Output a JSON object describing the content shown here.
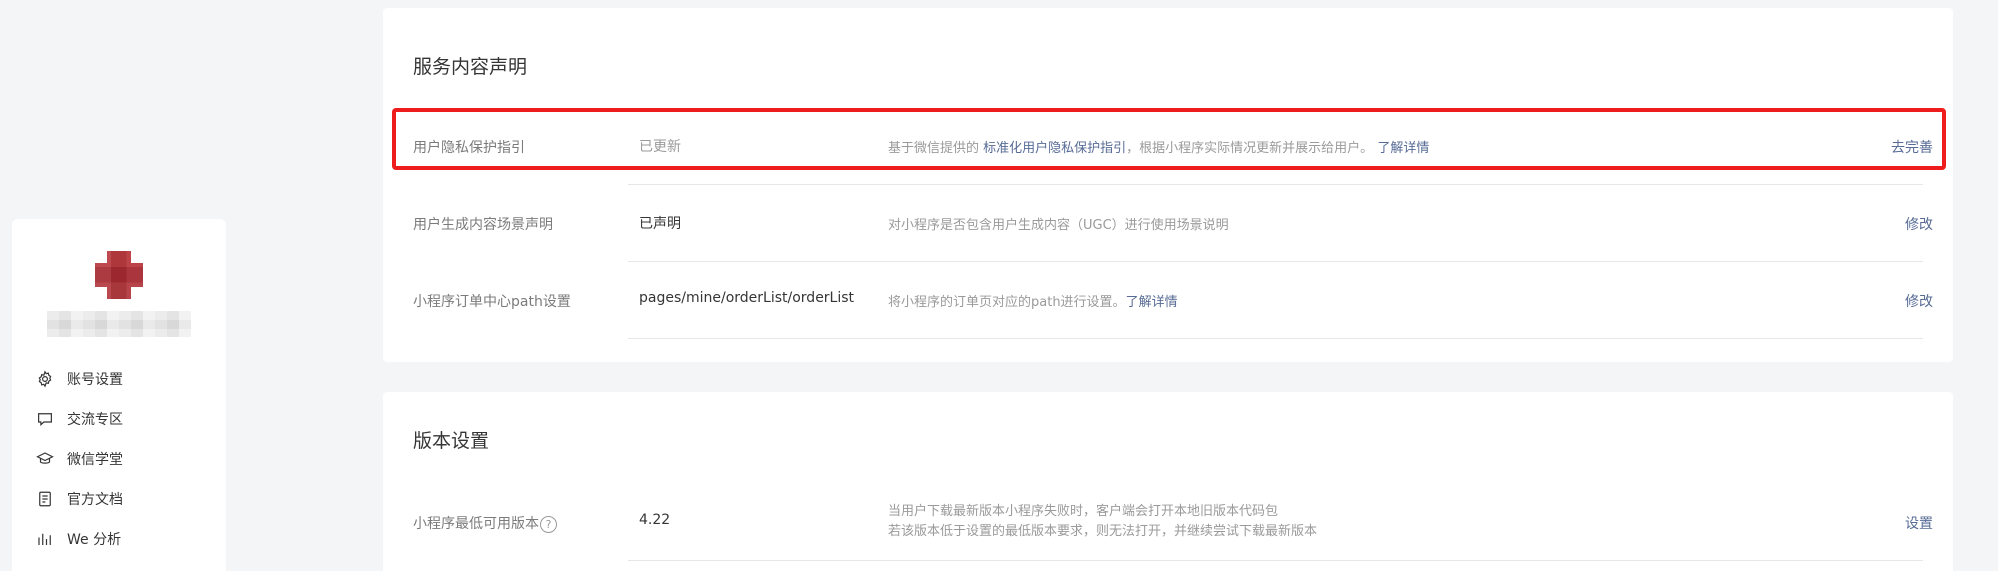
{
  "sidebar": {
    "menu": [
      {
        "label": "账号设置",
        "icon": "gear-icon"
      },
      {
        "label": "交流专区",
        "icon": "chat-bubble-icon"
      },
      {
        "label": "微信学堂",
        "icon": "graduation-cap-icon"
      },
      {
        "label": "官方文档",
        "icon": "document-icon"
      },
      {
        "label": "We 分析",
        "icon": "bar-analytics-icon"
      }
    ]
  },
  "service_card": {
    "title": "服务内容声明",
    "rows": [
      {
        "label": "用户隐私保护指引",
        "status": "已更新",
        "desc_prefix": "基于微信提供的 ",
        "desc_link": "标准化用户隐私保护指引",
        "desc_suffix": "，根据小程序实际情况更新并展示给用户。",
        "desc_more": "了解详情",
        "action": "去完善"
      },
      {
        "label": "用户生成内容场景声明",
        "status": "已声明",
        "desc": "对小程序是否包含用户生成内容（UGC）进行使用场景说明",
        "action": "修改"
      },
      {
        "label": "小程序订单中心path设置",
        "status": "pages/mine/orderList/orderList",
        "desc": "将小程序的订单页对应的path进行设置。",
        "desc_more": "了解详情",
        "action": "修改"
      }
    ]
  },
  "version_card": {
    "title": "版本设置",
    "rows": [
      {
        "label": "小程序最低可用版本",
        "help": "?",
        "status": "4.22",
        "desc_line1": "当用户下载最新版本小程序失败时，客户端会打开本地旧版本代码包",
        "desc_line2": "若该版本低于设置的最低版本要求，则无法打开，并继续尝试下载最新版本",
        "action": "设置"
      }
    ]
  },
  "colors": {
    "link": "#576b95",
    "highlight_border": "#ee1c1c",
    "muted_text": "#9a9a9a"
  }
}
